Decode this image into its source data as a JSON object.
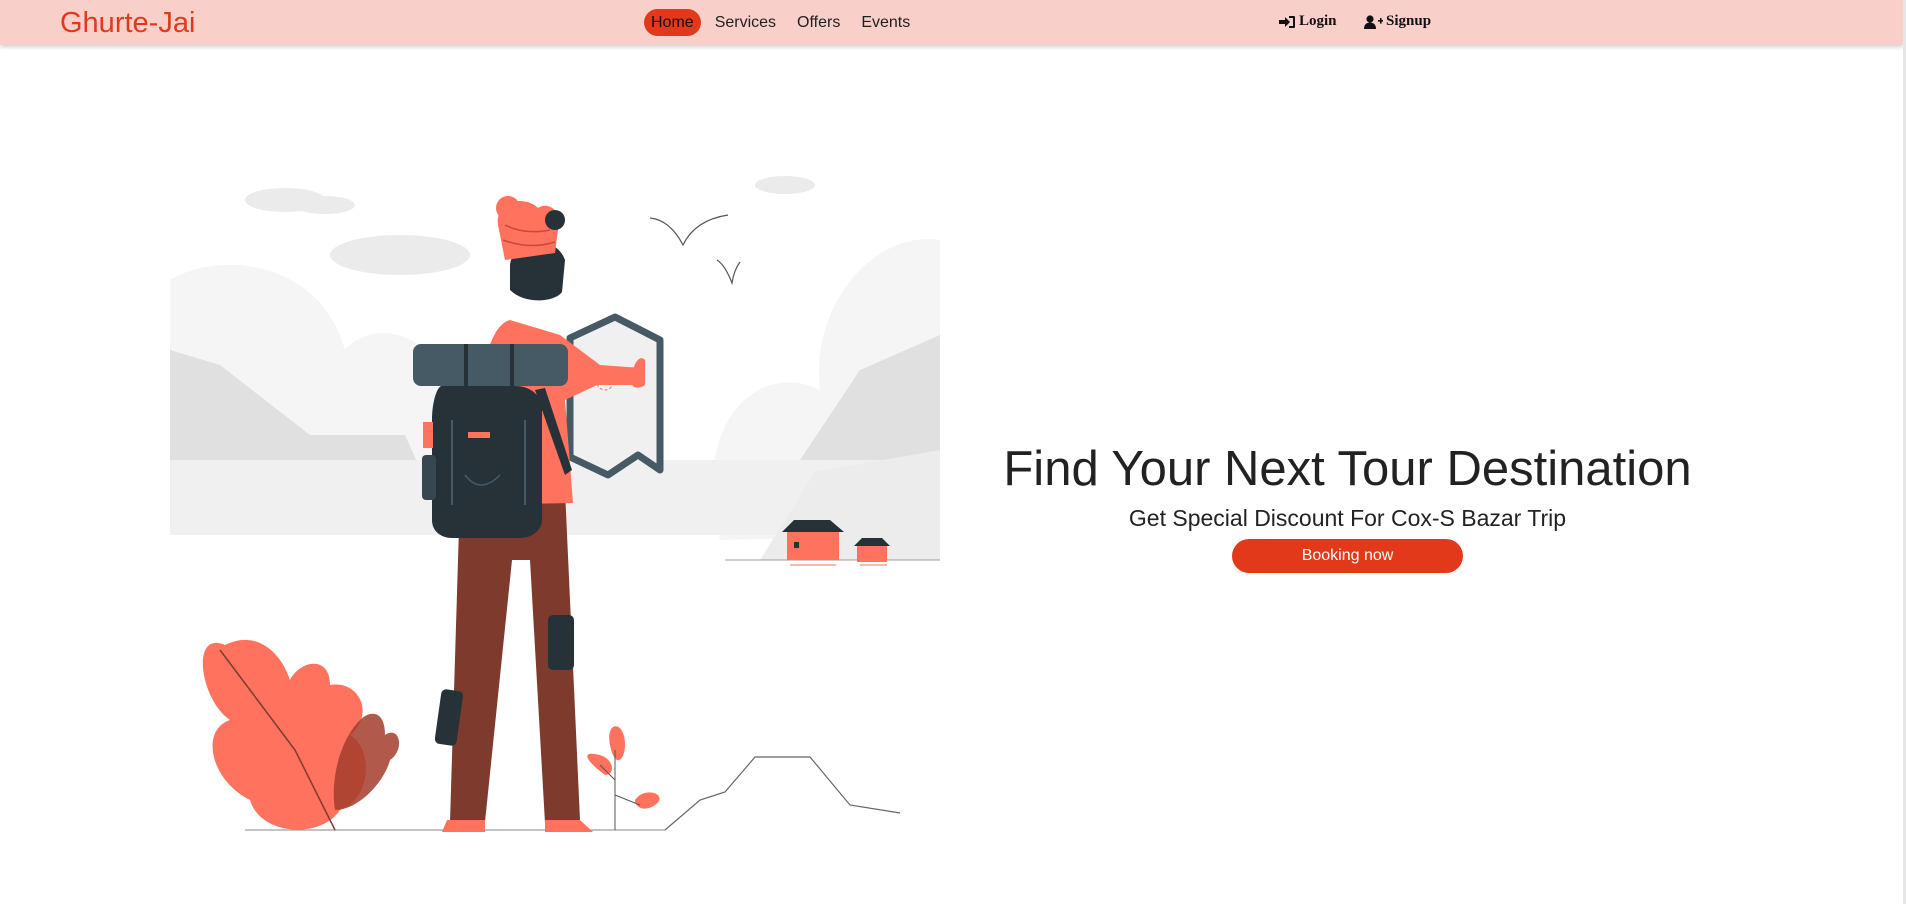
{
  "brand": "Ghurte-Jai",
  "nav": {
    "items": [
      {
        "label": "Home",
        "active": true
      },
      {
        "label": "Services",
        "active": false
      },
      {
        "label": "Offers",
        "active": false
      },
      {
        "label": "Events",
        "active": false
      }
    ]
  },
  "auth": {
    "login_label": "Login",
    "login_icon": "sign-in-icon",
    "signup_label": "Signup",
    "signup_icon": "user-plus-icon"
  },
  "hero": {
    "title": "Find Your Next Tour Destination",
    "subtitle": "Get Special Discount For Cox-S Bazar Trip",
    "button_label": "Booking now",
    "illustration": "traveler-with-map-illustration"
  },
  "colors": {
    "accent": "#e2391a",
    "navbar_bg": "#f9d0c9",
    "illustration_orange": "#ff725e",
    "illustration_dark": "#263238",
    "illustration_pants": "#7f3a2e"
  }
}
